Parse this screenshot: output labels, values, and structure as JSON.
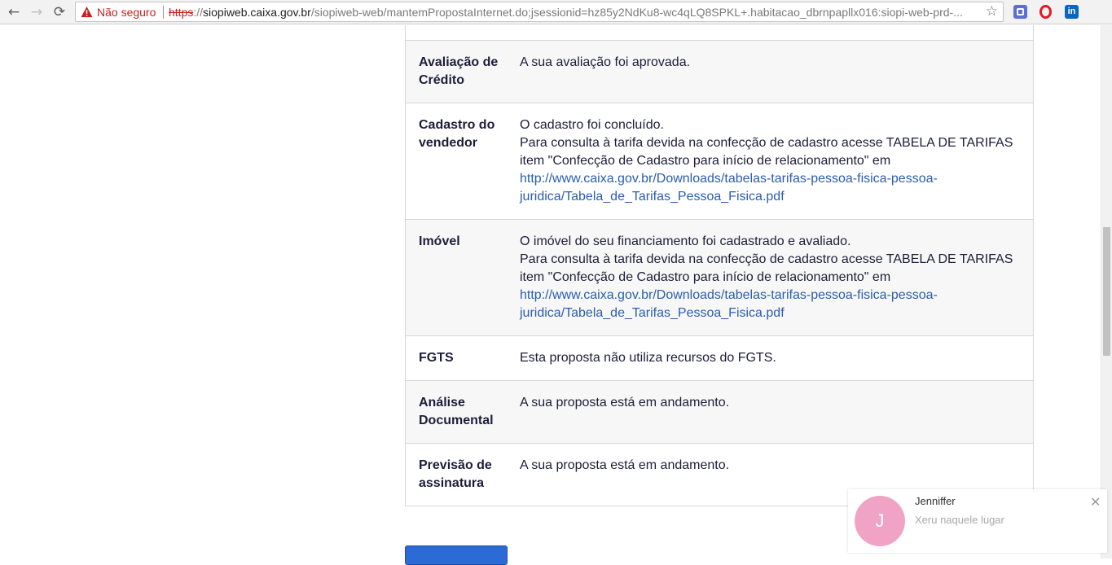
{
  "browser": {
    "back_glyph": "←",
    "forward_glyph": "→",
    "reload_glyph": "⟳",
    "security_label": "Não seguro",
    "url_scheme": "https",
    "url_sep": "://",
    "url_host": "siopiweb.caixa.gov.br",
    "url_path": "/siopiweb-web/mantemPropostaInternet.do;jsessionid=hz85y2NdKu8-wc4qLQ8SPKL+.habitacao_dbrnpapllx016:siopi-web-prd-...",
    "bookmark_glyph": "☆",
    "extensions": [
      "translate-icon",
      "opera-icon",
      "linkedin-icon"
    ],
    "linkedin_text": "in"
  },
  "status_rows": [
    {
      "label": "Avaliação de Crédito",
      "lines": [
        "A sua avaliação foi aprovada."
      ],
      "link": ""
    },
    {
      "label": "Cadastro do vendedor",
      "lines": [
        "O cadastro foi concluído.",
        "Para consulta à tarifa devida na confecção de cadastro acesse TABELA DE TARIFAS item \"Confecção de Cadastro para início de relacionamento\" em"
      ],
      "link": "http://www.caixa.gov.br/Downloads/tabelas-tarifas-pessoa-fisica-pessoa-juridica/Tabela_de_Tarifas_Pessoa_Fisica.pdf"
    },
    {
      "label": "Imóvel",
      "lines": [
        "O imóvel do seu financiamento foi cadastrado e avaliado.",
        "Para consulta à tarifa devida na confecção de cadastro acesse TABELA DE TARIFAS item \"Confecção de Cadastro para início de relacionamento\" em"
      ],
      "link": "http://www.caixa.gov.br/Downloads/tabelas-tarifas-pessoa-fisica-pessoa-juridica/Tabela_de_Tarifas_Pessoa_Fisica.pdf"
    },
    {
      "label": "FGTS",
      "lines": [
        "Esta proposta não utiliza recursos do FGTS."
      ],
      "link": ""
    },
    {
      "label": "Análise Documental",
      "lines": [
        "A sua proposta está em andamento."
      ],
      "link": ""
    },
    {
      "label": "Previsão de assinatura",
      "lines": [
        "A sua proposta está em andamento."
      ],
      "link": ""
    }
  ],
  "notification": {
    "avatar_initial": "J",
    "name": "Jenniffer",
    "message": "Xeru naquele lugar",
    "close_glyph": "✕"
  },
  "colors": {
    "accent_button": "#2c6bd6",
    "link": "#2a5db0",
    "warning": "#c5221f",
    "avatar": "#f1a3c6"
  }
}
